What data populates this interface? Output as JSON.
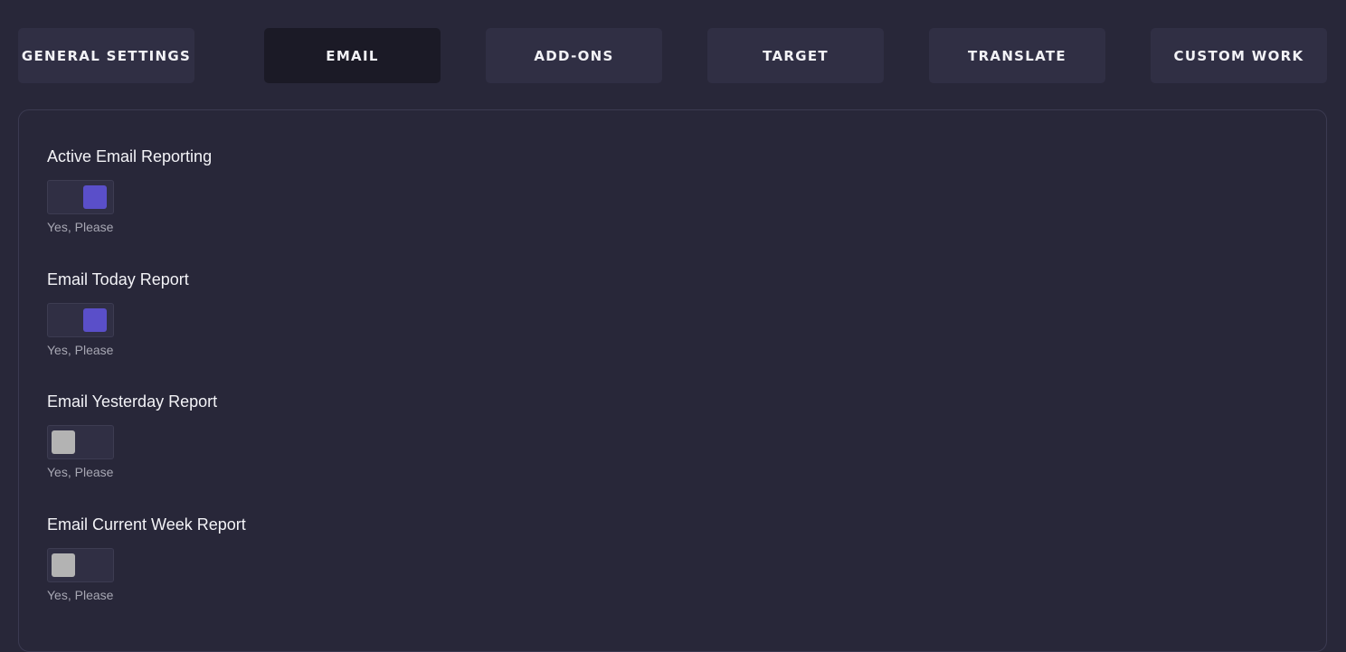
{
  "tabs": [
    {
      "label": "GENERAL SETTINGS",
      "active": false
    },
    {
      "label": "EMAIL",
      "active": true
    },
    {
      "label": "ADD-ONS",
      "active": false
    },
    {
      "label": "TARGET",
      "active": false
    },
    {
      "label": "TRANSLATE",
      "active": false
    },
    {
      "label": "CUSTOM WORK",
      "active": false
    }
  ],
  "settings": [
    {
      "label": "Active Email Reporting",
      "hint": "Yes, Please",
      "enabled": true
    },
    {
      "label": "Email Today Report",
      "hint": "Yes, Please",
      "enabled": true
    },
    {
      "label": "Email Yesterday Report",
      "hint": "Yes, Please",
      "enabled": false
    },
    {
      "label": "Email Current Week Report",
      "hint": "Yes, Please",
      "enabled": false
    }
  ],
  "colors": {
    "background": "#282739",
    "tab": "#302f44",
    "tab_active": "#1b1a26",
    "toggle_on": "#5a4fc9",
    "toggle_off": "#b3b3b3"
  }
}
